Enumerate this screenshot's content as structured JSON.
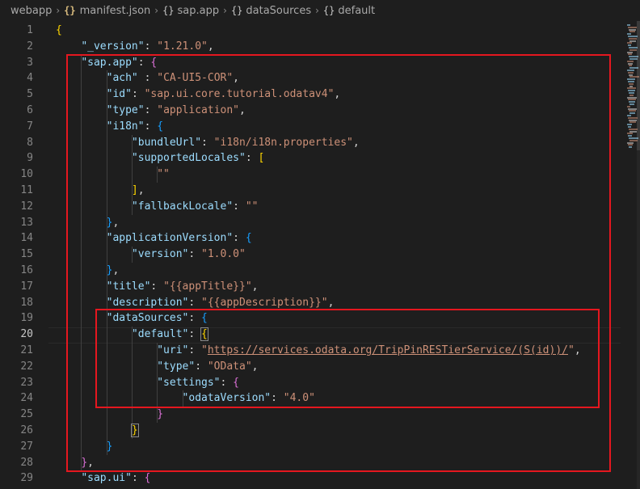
{
  "breadcrumb": {
    "folder": "webapp",
    "file_icon": "{}",
    "file": "manifest.json",
    "obj_icon": "{}",
    "items": [
      "sap.app",
      "dataSources",
      "default"
    ]
  },
  "editor": {
    "active_line": 20,
    "line_numbers": [
      "1",
      "2",
      "3",
      "4",
      "5",
      "6",
      "7",
      "8",
      "9",
      "10",
      "11",
      "12",
      "13",
      "14",
      "15",
      "16",
      "17",
      "18",
      "19",
      "20",
      "21",
      "22",
      "23",
      "24",
      "25",
      "26",
      "27",
      "28",
      "29"
    ],
    "lines": [
      [
        [
          "b1",
          "{"
        ]
      ],
      [
        [
          "p",
          "    "
        ],
        [
          "k",
          "\"_version\""
        ],
        [
          "p",
          ": "
        ],
        [
          "s",
          "\"1.21.0\""
        ],
        [
          "p",
          ","
        ]
      ],
      [
        [
          "p",
          "    "
        ],
        [
          "k",
          "\"sap.app\""
        ],
        [
          "p",
          ": "
        ],
        [
          "b2",
          "{"
        ]
      ],
      [
        [
          "p",
          "        "
        ],
        [
          "k",
          "\"ach\""
        ],
        [
          "p",
          " : "
        ],
        [
          "s",
          "\"CA-UI5-COR\""
        ],
        [
          "p",
          ","
        ]
      ],
      [
        [
          "p",
          "        "
        ],
        [
          "k",
          "\"id\""
        ],
        [
          "p",
          ": "
        ],
        [
          "s",
          "\"sap.ui.core.tutorial.odatav4\""
        ],
        [
          "p",
          ","
        ]
      ],
      [
        [
          "p",
          "        "
        ],
        [
          "k",
          "\"type\""
        ],
        [
          "p",
          ": "
        ],
        [
          "s",
          "\"application\""
        ],
        [
          "p",
          ","
        ]
      ],
      [
        [
          "p",
          "        "
        ],
        [
          "k",
          "\"i18n\""
        ],
        [
          "p",
          ": "
        ],
        [
          "b3",
          "{"
        ]
      ],
      [
        [
          "p",
          "            "
        ],
        [
          "k",
          "\"bundleUrl\""
        ],
        [
          "p",
          ": "
        ],
        [
          "s",
          "\"i18n/i18n.properties\""
        ],
        [
          "p",
          ","
        ]
      ],
      [
        [
          "p",
          "            "
        ],
        [
          "k",
          "\"supportedLocales\""
        ],
        [
          "p",
          ": "
        ],
        [
          "b1",
          "["
        ]
      ],
      [
        [
          "p",
          "                "
        ],
        [
          "s",
          "\"\""
        ]
      ],
      [
        [
          "p",
          "            "
        ],
        [
          "b1",
          "]"
        ],
        [
          "p",
          ","
        ]
      ],
      [
        [
          "p",
          "            "
        ],
        [
          "k",
          "\"fallbackLocale\""
        ],
        [
          "p",
          ": "
        ],
        [
          "s",
          "\"\""
        ]
      ],
      [
        [
          "p",
          "        "
        ],
        [
          "b3",
          "}"
        ],
        [
          "p",
          ","
        ]
      ],
      [
        [
          "p",
          "        "
        ],
        [
          "k",
          "\"applicationVersion\""
        ],
        [
          "p",
          ": "
        ],
        [
          "b3",
          "{"
        ]
      ],
      [
        [
          "p",
          "            "
        ],
        [
          "k",
          "\"version\""
        ],
        [
          "p",
          ": "
        ],
        [
          "s",
          "\"1.0.0\""
        ]
      ],
      [
        [
          "p",
          "        "
        ],
        [
          "b3",
          "}"
        ],
        [
          "p",
          ","
        ]
      ],
      [
        [
          "p",
          "        "
        ],
        [
          "k",
          "\"title\""
        ],
        [
          "p",
          ": "
        ],
        [
          "s",
          "\"{{appTitle}}\""
        ],
        [
          "p",
          ","
        ]
      ],
      [
        [
          "p",
          "        "
        ],
        [
          "k",
          "\"description\""
        ],
        [
          "p",
          ": "
        ],
        [
          "s",
          "\"{{appDescription}}\""
        ],
        [
          "p",
          ","
        ]
      ],
      [
        [
          "p",
          "        "
        ],
        [
          "k",
          "\"dataSources\""
        ],
        [
          "p",
          ": "
        ],
        [
          "b3",
          "{"
        ]
      ],
      [
        [
          "p",
          "            "
        ],
        [
          "k",
          "\"default\""
        ],
        [
          "p",
          ": "
        ],
        [
          "b1",
          "{"
        ]
      ],
      [
        [
          "p",
          "                "
        ],
        [
          "k",
          "\"uri\""
        ],
        [
          "p",
          ": "
        ],
        [
          "s",
          "\""
        ],
        [
          "su",
          "https://services.odata.org/TripPinRESTierService/(S(id))/"
        ],
        [
          "s",
          "\""
        ],
        [
          "p",
          ","
        ]
      ],
      [
        [
          "p",
          "                "
        ],
        [
          "k",
          "\"type\""
        ],
        [
          "p",
          ": "
        ],
        [
          "s",
          "\"OData\""
        ],
        [
          "p",
          ","
        ]
      ],
      [
        [
          "p",
          "                "
        ],
        [
          "k",
          "\"settings\""
        ],
        [
          "p",
          ": "
        ],
        [
          "b2",
          "{"
        ]
      ],
      [
        [
          "p",
          "                    "
        ],
        [
          "k",
          "\"odataVersion\""
        ],
        [
          "p",
          ": "
        ],
        [
          "s",
          "\"4.0\""
        ]
      ],
      [
        [
          "p",
          "                "
        ],
        [
          "b2",
          "}"
        ]
      ],
      [
        [
          "p",
          "            "
        ],
        [
          "b1",
          "}"
        ]
      ],
      [
        [
          "p",
          "        "
        ],
        [
          "b3",
          "}"
        ]
      ],
      [
        [
          "p",
          "    "
        ],
        [
          "b2",
          "}"
        ],
        [
          "p",
          ","
        ]
      ],
      [
        [
          "p",
          "    "
        ],
        [
          "k",
          "\"sap.ui\""
        ],
        [
          "p",
          ": "
        ],
        [
          "b2",
          "{"
        ]
      ]
    ]
  },
  "colors": {
    "background": "#1e1e1e",
    "annotation_box": "#e5171f",
    "key": "#9cdcfe",
    "string": "#ce9178"
  }
}
